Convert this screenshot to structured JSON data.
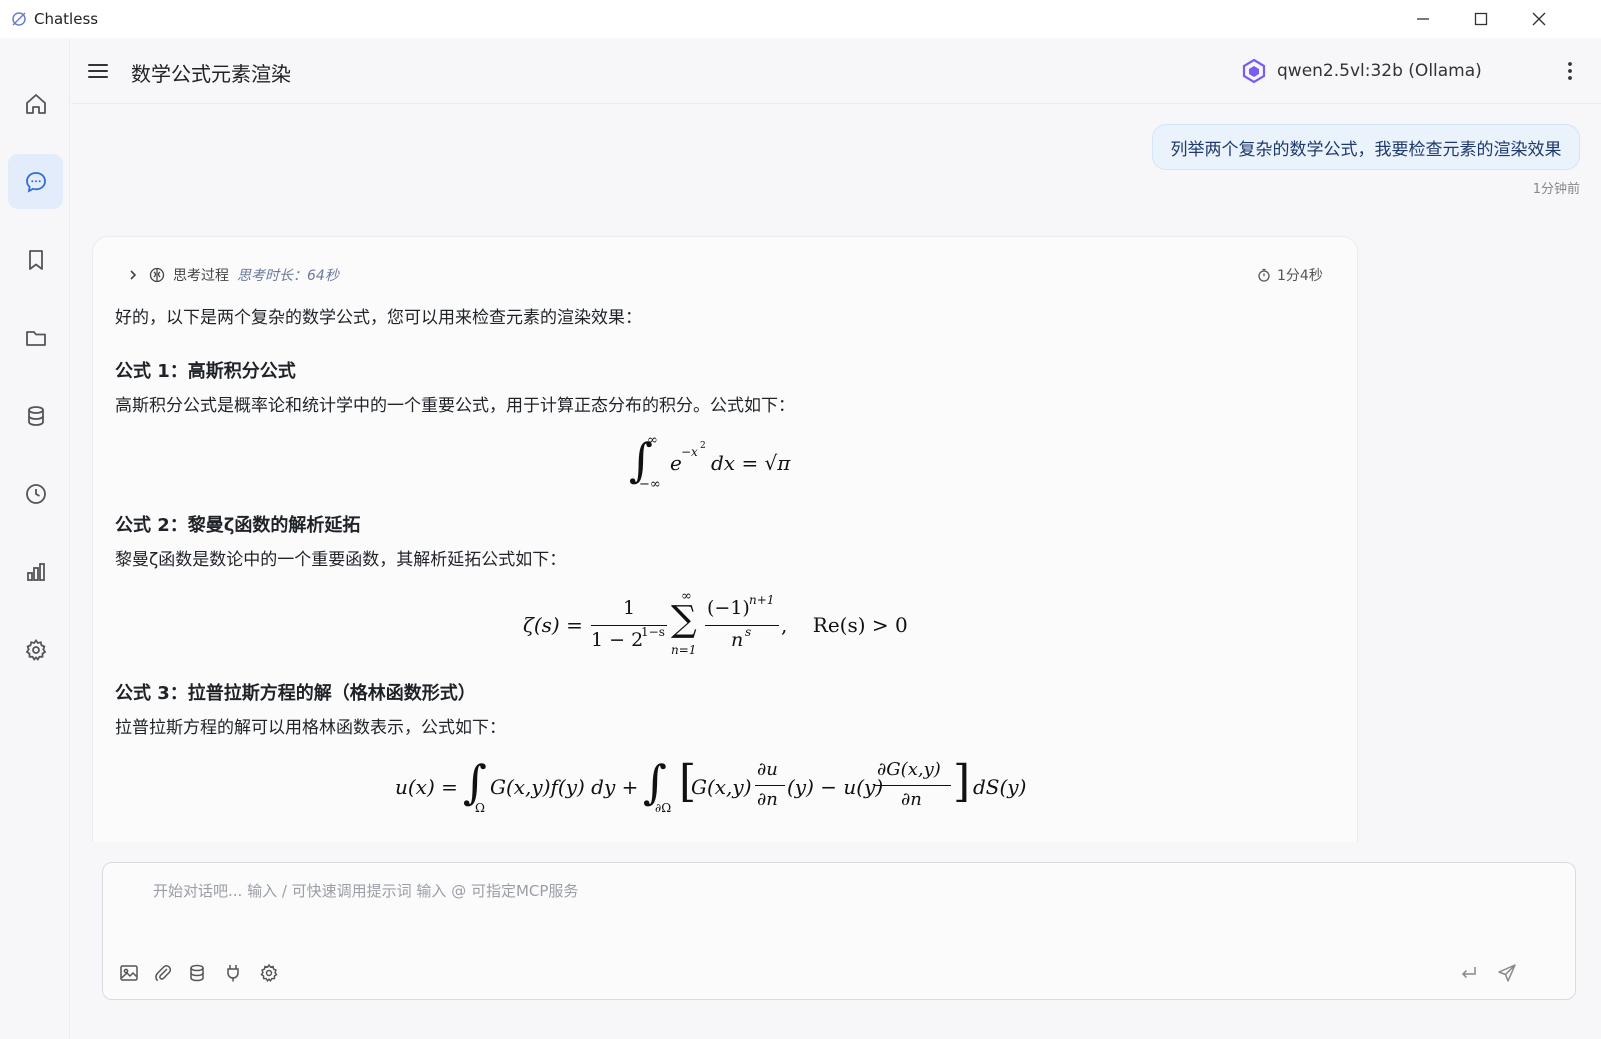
{
  "window": {
    "title": "Chatless"
  },
  "header": {
    "title": "数学公式元素渲染",
    "model": "qwen2.5vl:32b (Ollama)"
  },
  "sidebar": {
    "items": [
      {
        "icon": "home-icon"
      },
      {
        "icon": "chat-icon",
        "active": true
      },
      {
        "icon": "bookmark-icon"
      },
      {
        "icon": "folder-icon"
      },
      {
        "icon": "database-icon"
      },
      {
        "icon": "clock-icon"
      },
      {
        "icon": "chart-icon"
      },
      {
        "icon": "gear-icon"
      }
    ]
  },
  "user_message": {
    "text": "列举两个复杂的数学公式，我要检查元素的渲染效果",
    "time": "1分钟前"
  },
  "assistant": {
    "thinking_label": "思考过程",
    "thinking_duration": "思考时长：64秒",
    "elapsed": "1分4秒",
    "intro": "好的，以下是两个复杂的数学公式，您可以用来检查元素的渲染效果：",
    "sections": [
      {
        "heading": "公式 1：高斯积分公式",
        "desc": "高斯积分公式是概率论和统计学中的一个重要公式，用于计算正态分布的积分。公式如下："
      },
      {
        "heading": "公式 2：黎曼ζ函数的解析延拓",
        "desc": "黎曼ζ函数是数论中的一个重要函数，其解析延拓公式如下："
      },
      {
        "heading": "公式 3：拉普拉斯方程的解（格林函数形式）",
        "desc": "拉普拉斯方程的解可以用格林函数表示，公式如下："
      }
    ]
  },
  "formulas": {
    "f1": {
      "int": "∫",
      "lower": "−∞",
      "upper": "∞",
      "base": "e",
      "exp": "−x",
      "exp2": "2",
      "rest": "dx = √π"
    },
    "f2": {
      "lhs": "ζ(s) =",
      "num": "1",
      "den": "1 − 2",
      "den_exp": "1−s",
      "sum": "∑",
      "sum_upper": "∞",
      "sum_lower": "n=1",
      "num2": "(−1)",
      "num2_exp": "n+1",
      "den2": "n",
      "den2_exp": "s",
      "tail": ",    Re(s) > 0"
    },
    "f3": {
      "a": "u(x) =",
      "int1_sub": "Ω",
      "b": "G(x,y)f(y) dy +",
      "int2_sub": "∂Ω",
      "c": "G(x,y)",
      "fr1_num": "∂u",
      "fr1_den": "∂n",
      "d": "(y) − u(y)",
      "fr2_num": "∂G(x,y)",
      "fr2_den": "∂n",
      "e": "dS(y)"
    }
  },
  "composer": {
    "placeholder": "开始对话吧... 输入 / 可快速调用提示词 输入 @ 可指定MCP服务"
  },
  "toolbar": {
    "tools": [
      "image-icon",
      "paperclip-icon",
      "database-icon",
      "plug-icon",
      "gear-icon"
    ]
  },
  "colors": {
    "accent": "#e3ecfb",
    "bubble": "#eaf2fc",
    "text": "#1f2328"
  }
}
